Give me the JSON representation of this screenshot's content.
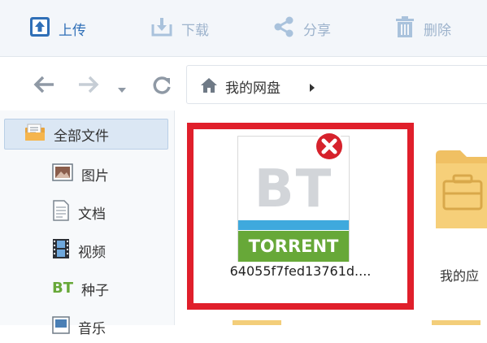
{
  "toolbar": {
    "upload_label": "上传",
    "download_label": "下载",
    "share_label": "分享",
    "delete_label": "删除"
  },
  "nav": {
    "path_root": "我的网盘"
  },
  "sidebar": {
    "items": [
      {
        "label": "全部文件",
        "icon": "folder-doc-icon",
        "selected": true
      },
      {
        "label": "图片",
        "icon": "image-icon"
      },
      {
        "label": "文档",
        "icon": "document-icon"
      },
      {
        "label": "视频",
        "icon": "film-icon"
      },
      {
        "label": "种子",
        "icon": "bt-icon"
      },
      {
        "label": "音乐",
        "icon": "music-icon"
      }
    ]
  },
  "files": [
    {
      "name": "64055f7fed13761d....",
      "thumb_text": "BT",
      "thumb_band": "TORRENT",
      "highlighted": true
    },
    {
      "name": "我的应",
      "type": "folder"
    }
  ],
  "colors": {
    "accent": "#2f6fb7",
    "highlight_border": "#e01f2b",
    "torrent_green": "#67a838",
    "torrent_blue": "#3fa9dd",
    "folder": "#f3ce7a"
  }
}
